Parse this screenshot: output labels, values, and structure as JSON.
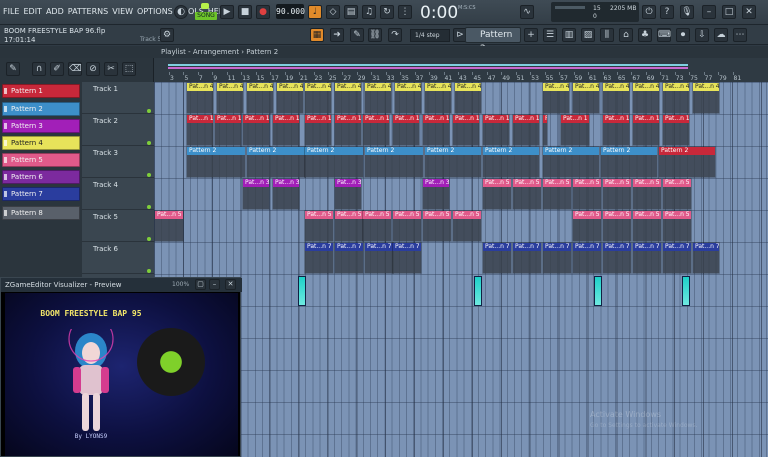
{
  "menu": [
    "FILE",
    "EDIT",
    "ADD",
    "PATTERNS",
    "VIEW",
    "OPTIONS",
    "TOOLS",
    "HELP"
  ],
  "transport": {
    "song_label": "SONG",
    "tempo": "90.000",
    "time": "0:00",
    "time_unit": "M:S:CS",
    "play_icon": "play-icon",
    "stop_icon": "stop-icon",
    "record_icon": "record-icon"
  },
  "cpu": {
    "value1": "15",
    "memory": "2205 MB",
    "value3": "0"
  },
  "project": {
    "name": "BOOM FREESTYLE BAP 96.flp",
    "time": "17:01:14",
    "track_hint": "Track 5"
  },
  "snap": "1/4 step",
  "pattern_selector": "Pattern 2",
  "playlist": {
    "title": "Playlist - Arrangement › Pattern 2"
  },
  "ruler_ticks": [
    "3",
    "5",
    "7",
    "9",
    "11",
    "13",
    "15",
    "17",
    "19",
    "21",
    "23",
    "25",
    "27",
    "29",
    "31",
    "33",
    "35",
    "37",
    "39",
    "41",
    "43",
    "45",
    "47",
    "49",
    "51",
    "53",
    "55",
    "57",
    "59",
    "61",
    "63",
    "65",
    "67",
    "69",
    "71",
    "73",
    "75",
    "77",
    "79",
    "81"
  ],
  "patterns": [
    {
      "name": "Pattern 1",
      "color": "#c8283a"
    },
    {
      "name": "Pattern 2",
      "color": "#3d8fc9"
    },
    {
      "name": "Pattern 3",
      "color": "#a21fb8"
    },
    {
      "name": "Pattern 4",
      "color": "#e7e35a"
    },
    {
      "name": "Pattern 5",
      "color": "#e05a8a"
    },
    {
      "name": "Pattern 6",
      "color": "#7c2a9e"
    },
    {
      "name": "Pattern 7",
      "color": "#2a3d9e"
    },
    {
      "name": "Pattern 8",
      "color": "#59606a"
    }
  ],
  "tracks": [
    "Track 1",
    "Track 2",
    "Track 3",
    "Track 4",
    "Track 5",
    "Track 6"
  ],
  "clip_labels": {
    "p4": "Pat...n 4",
    "p1": "Pat...n 1",
    "p2": "Pattern 2",
    "p3": "Pat...n 3",
    "p5": "Pat...n 5",
    "p7": "Pat...n 7"
  },
  "preview": {
    "title": "ZGameEditor Visualizer - Preview",
    "zoom": "100%",
    "art_title": "BOOM FREESTYLE BAP 95",
    "art_sub": "By LYONS9"
  },
  "watermark": {
    "line1": "Activate Windows",
    "line2": "Go to Settings to activate Windows."
  }
}
